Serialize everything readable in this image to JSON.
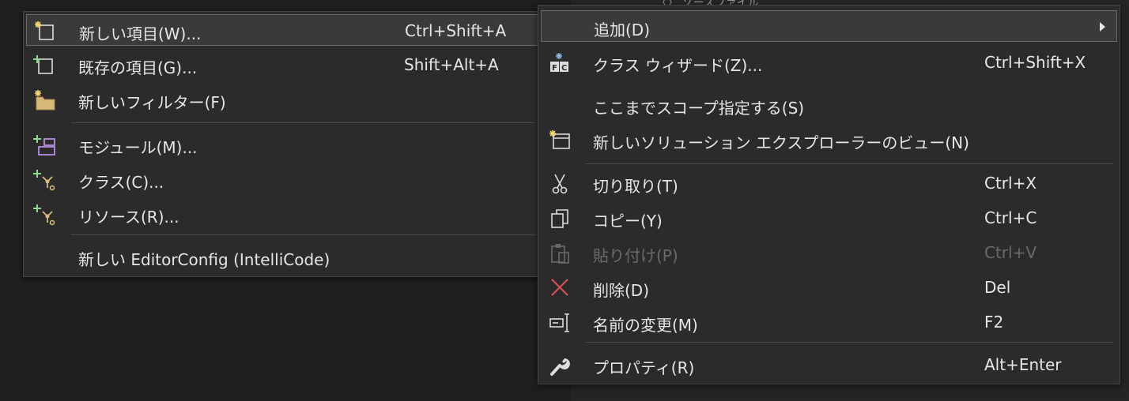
{
  "background": {
    "partial_text": "〈〉 ソースファイル"
  },
  "submenu": {
    "items": [
      {
        "label": "新しい項目(W)...",
        "shortcut": "Ctrl+Shift+A",
        "icon": "new-item-icon"
      },
      {
        "label": "既存の項目(G)...",
        "shortcut": "Shift+Alt+A",
        "icon": "existing-item-icon"
      },
      {
        "label": "新しいフィルター(F)",
        "shortcut": "",
        "icon": "new-filter-icon"
      },
      {
        "label": "モジュール(M)...",
        "shortcut": "",
        "icon": "module-icon"
      },
      {
        "label": "クラス(C)...",
        "shortcut": "",
        "icon": "class-icon"
      },
      {
        "label": "リソース(R)...",
        "shortcut": "",
        "icon": "resource-icon"
      },
      {
        "label": "新しい EditorConfig (IntelliCode)",
        "shortcut": "",
        "icon": ""
      }
    ]
  },
  "context": {
    "items": [
      {
        "label": "追加(D)",
        "shortcut": "",
        "icon": ""
      },
      {
        "label": "クラス ウィザード(Z)...",
        "shortcut": "Ctrl+Shift+X",
        "icon": "class-wizard-icon"
      },
      {
        "label": "ここまでスコープ指定する(S)",
        "shortcut": "",
        "icon": ""
      },
      {
        "label": "新しいソリューション エクスプローラーのビュー(N)",
        "shortcut": "",
        "icon": "new-view-icon"
      },
      {
        "label": "切り取り(T)",
        "shortcut": "Ctrl+X",
        "icon": "scissors-icon"
      },
      {
        "label": "コピー(Y)",
        "shortcut": "Ctrl+C",
        "icon": "copy-icon"
      },
      {
        "label": "貼り付け(P)",
        "shortcut": "Ctrl+V",
        "icon": "paste-icon",
        "disabled": true
      },
      {
        "label": "削除(D)",
        "shortcut": "Del",
        "icon": "delete-icon"
      },
      {
        "label": "名前の変更(M)",
        "shortcut": "F2",
        "icon": "rename-icon"
      },
      {
        "label": "プロパティ(R)",
        "shortcut": "Alt+Enter",
        "icon": "wrench-icon"
      }
    ]
  },
  "colors": {
    "menu_bg": "#2b2b2b",
    "highlight": "#3a3a3a",
    "delete_red": "#e05252",
    "new_star": "#f5d76e",
    "add_green": "#8fd88f",
    "module_purple": "#b48ee0",
    "folder_tan": "#d8b97a"
  }
}
